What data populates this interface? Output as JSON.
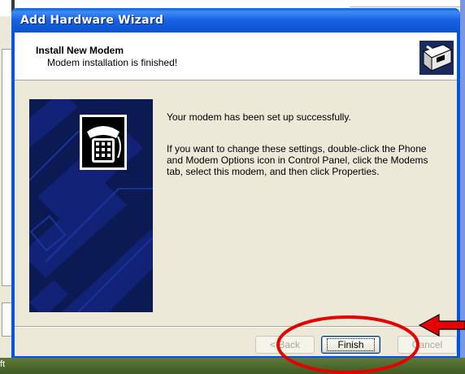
{
  "dialog": {
    "title": "Add Hardware Wizard",
    "header_title": "Install New Modem",
    "header_subtitle": "Modem installation is finished!",
    "message_1": "Your modem has been set up successfully.",
    "message_2": "If you want to change these settings, double-click the Phone and Modem Options icon in Control Panel, click the Modems tab, select this modem, and then click Properties.",
    "buttons": {
      "back": "< Back",
      "finish": "Finish",
      "cancel": "Cancel"
    }
  },
  "taskbar": {
    "text": "ft"
  },
  "icons": {
    "header": "hardware-device-icon",
    "side": "telephone-icon"
  },
  "colors": {
    "titlebar": "#0a52d0",
    "annotation": "#e60000"
  }
}
